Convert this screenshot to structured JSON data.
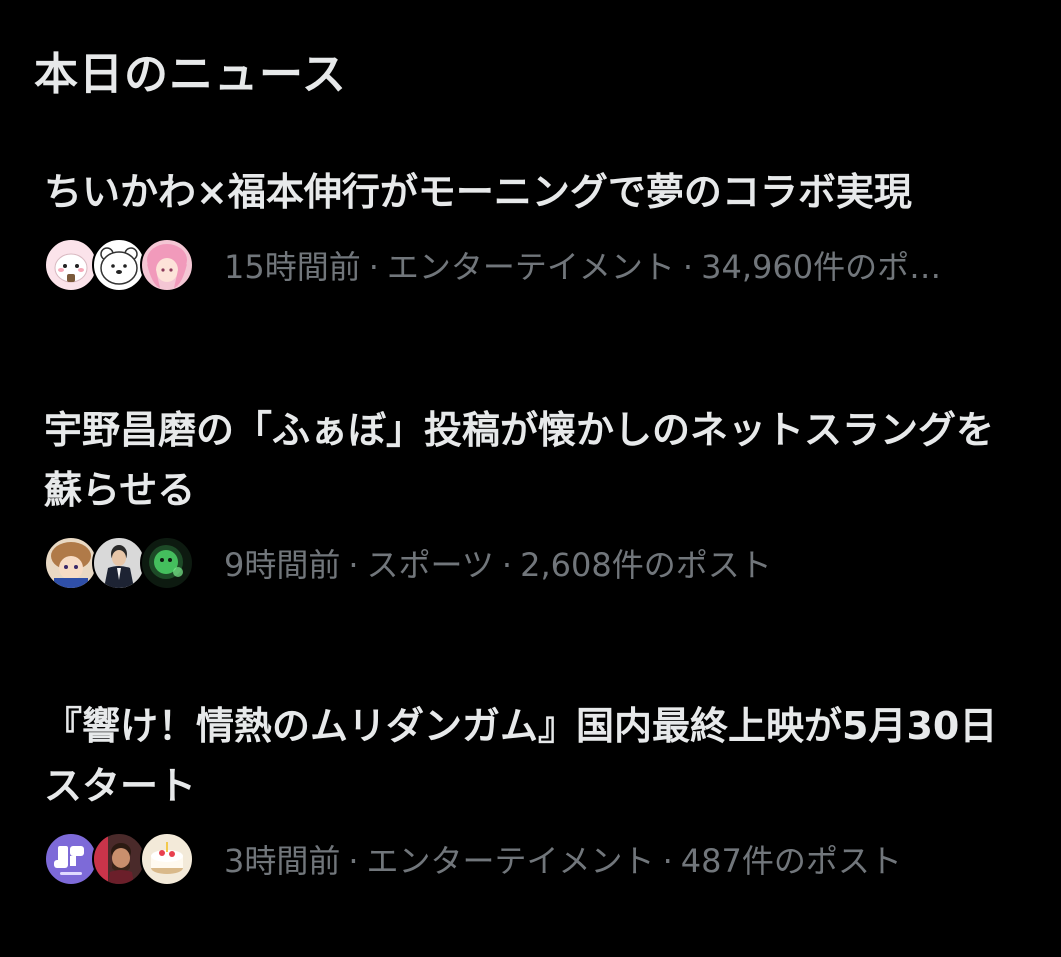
{
  "section": {
    "title": "本日のニュース"
  },
  "news": [
    {
      "headline": "ちいかわ×福本伸行がモーニングで夢のコラボ実現",
      "time": "15時間前",
      "category": "エンターテイメント",
      "posts": "34,960件のポ…",
      "avatars": [
        "chiikawa-avatar",
        "white-bear-avatar",
        "pink-hair-avatar"
      ]
    },
    {
      "headline": "宇野昌磨の「ふぁぼ」投稿が懐かしのネットスラングを蘇らせる",
      "time": "9時間前",
      "category": "スポーツ",
      "posts": "2,608件のポスト",
      "avatars": [
        "anime-character-avatar",
        "man-in-suit-avatar",
        "green-glow-avatar"
      ]
    },
    {
      "headline": "『響け！情熱のムリダンガム』国内最終上映が5月30日スタート",
      "time": "3時間前",
      "category": "エンターテイメント",
      "posts": "487件のポスト",
      "avatars": [
        "natalie-logo-avatar",
        "bearded-man-avatar",
        "cake-avatar"
      ]
    }
  ],
  "colors": {
    "background": "#000000",
    "text_primary": "#e7e9ea",
    "text_secondary": "#71767b"
  }
}
